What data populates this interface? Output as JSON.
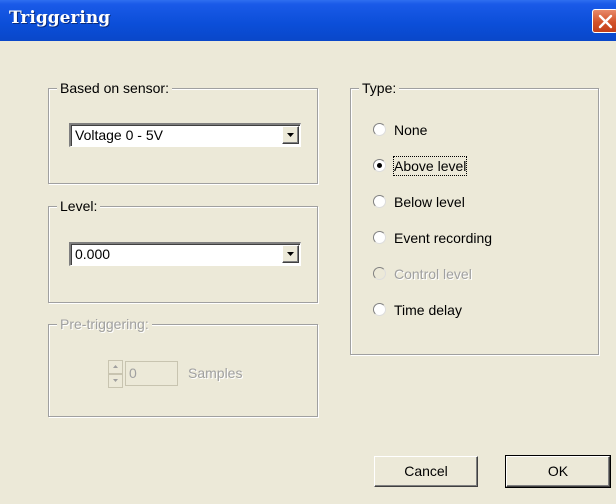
{
  "window": {
    "title": "Triggering"
  },
  "sensor_group": {
    "legend": "Based on sensor:",
    "selected": "Voltage 0 - 5V"
  },
  "level_group": {
    "legend": "Level:",
    "selected": "0.000"
  },
  "pretrigger_group": {
    "legend": "Pre-triggering:",
    "value": "0",
    "unit_label": "Samples",
    "enabled": false
  },
  "type_group": {
    "legend": "Type:",
    "options": [
      {
        "label": "None",
        "checked": false,
        "disabled": false
      },
      {
        "label": "Above level",
        "checked": true,
        "disabled": false
      },
      {
        "label": "Below level",
        "checked": false,
        "disabled": false
      },
      {
        "label": "Event recording",
        "checked": false,
        "disabled": false
      },
      {
        "label": "Control level",
        "checked": false,
        "disabled": true
      },
      {
        "label": "Time delay",
        "checked": false,
        "disabled": false
      }
    ]
  },
  "buttons": {
    "cancel": "Cancel",
    "ok": "OK"
  }
}
